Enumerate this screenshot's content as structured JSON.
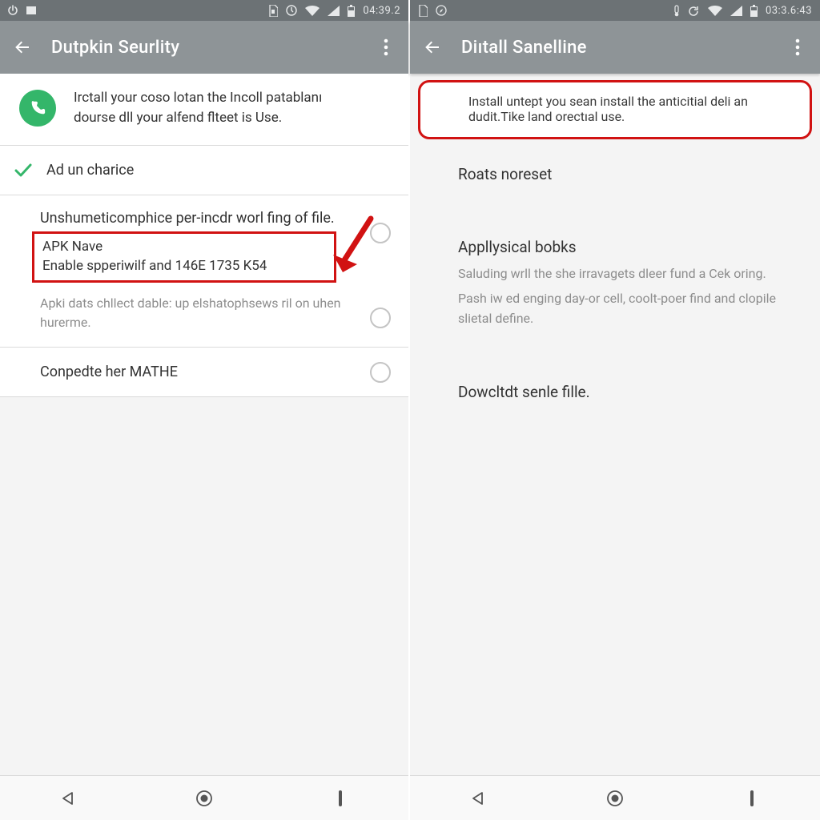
{
  "left": {
    "status": {
      "clock": "04:39.2"
    },
    "appbar": {
      "title": "Dutpkin Seurlity"
    },
    "banner": {
      "text": "Irctall your coso lotan the Incoll patablanı dourse dll your alfend flteet is Use."
    },
    "check_row": {
      "label": "Ad un charice"
    },
    "unknown_row": {
      "primary": "Unshumeticomphice per-incdr worl fing of file.",
      "apk_title": "APK Nave",
      "apk_sub": "Enable spperiwilf and 146E 1735 K54",
      "caption": "Apki dats chllect dable: up elshatophsews ril on uhen hurerme."
    },
    "last_row": {
      "label": "Conpedte her MATHE"
    }
  },
  "right": {
    "status": {
      "clock": "03:3.6:43"
    },
    "appbar": {
      "title": "Diıtall Sanelline"
    },
    "banner": {
      "text": "Install untept you sean install the anticitial deli an dudit.Tike land orectıal use."
    },
    "rows": {
      "r1": "Roats noreset",
      "r2_title": "Appllysical bobks",
      "r2_body1": "Saluding wrll the she irravagets dleer fund a Cek oring.",
      "r2_body2": "Pash iw ed enging day-or cell, coolt-poer find and clopile slietal define.",
      "r3": "Dowcltdt senle fille."
    }
  }
}
